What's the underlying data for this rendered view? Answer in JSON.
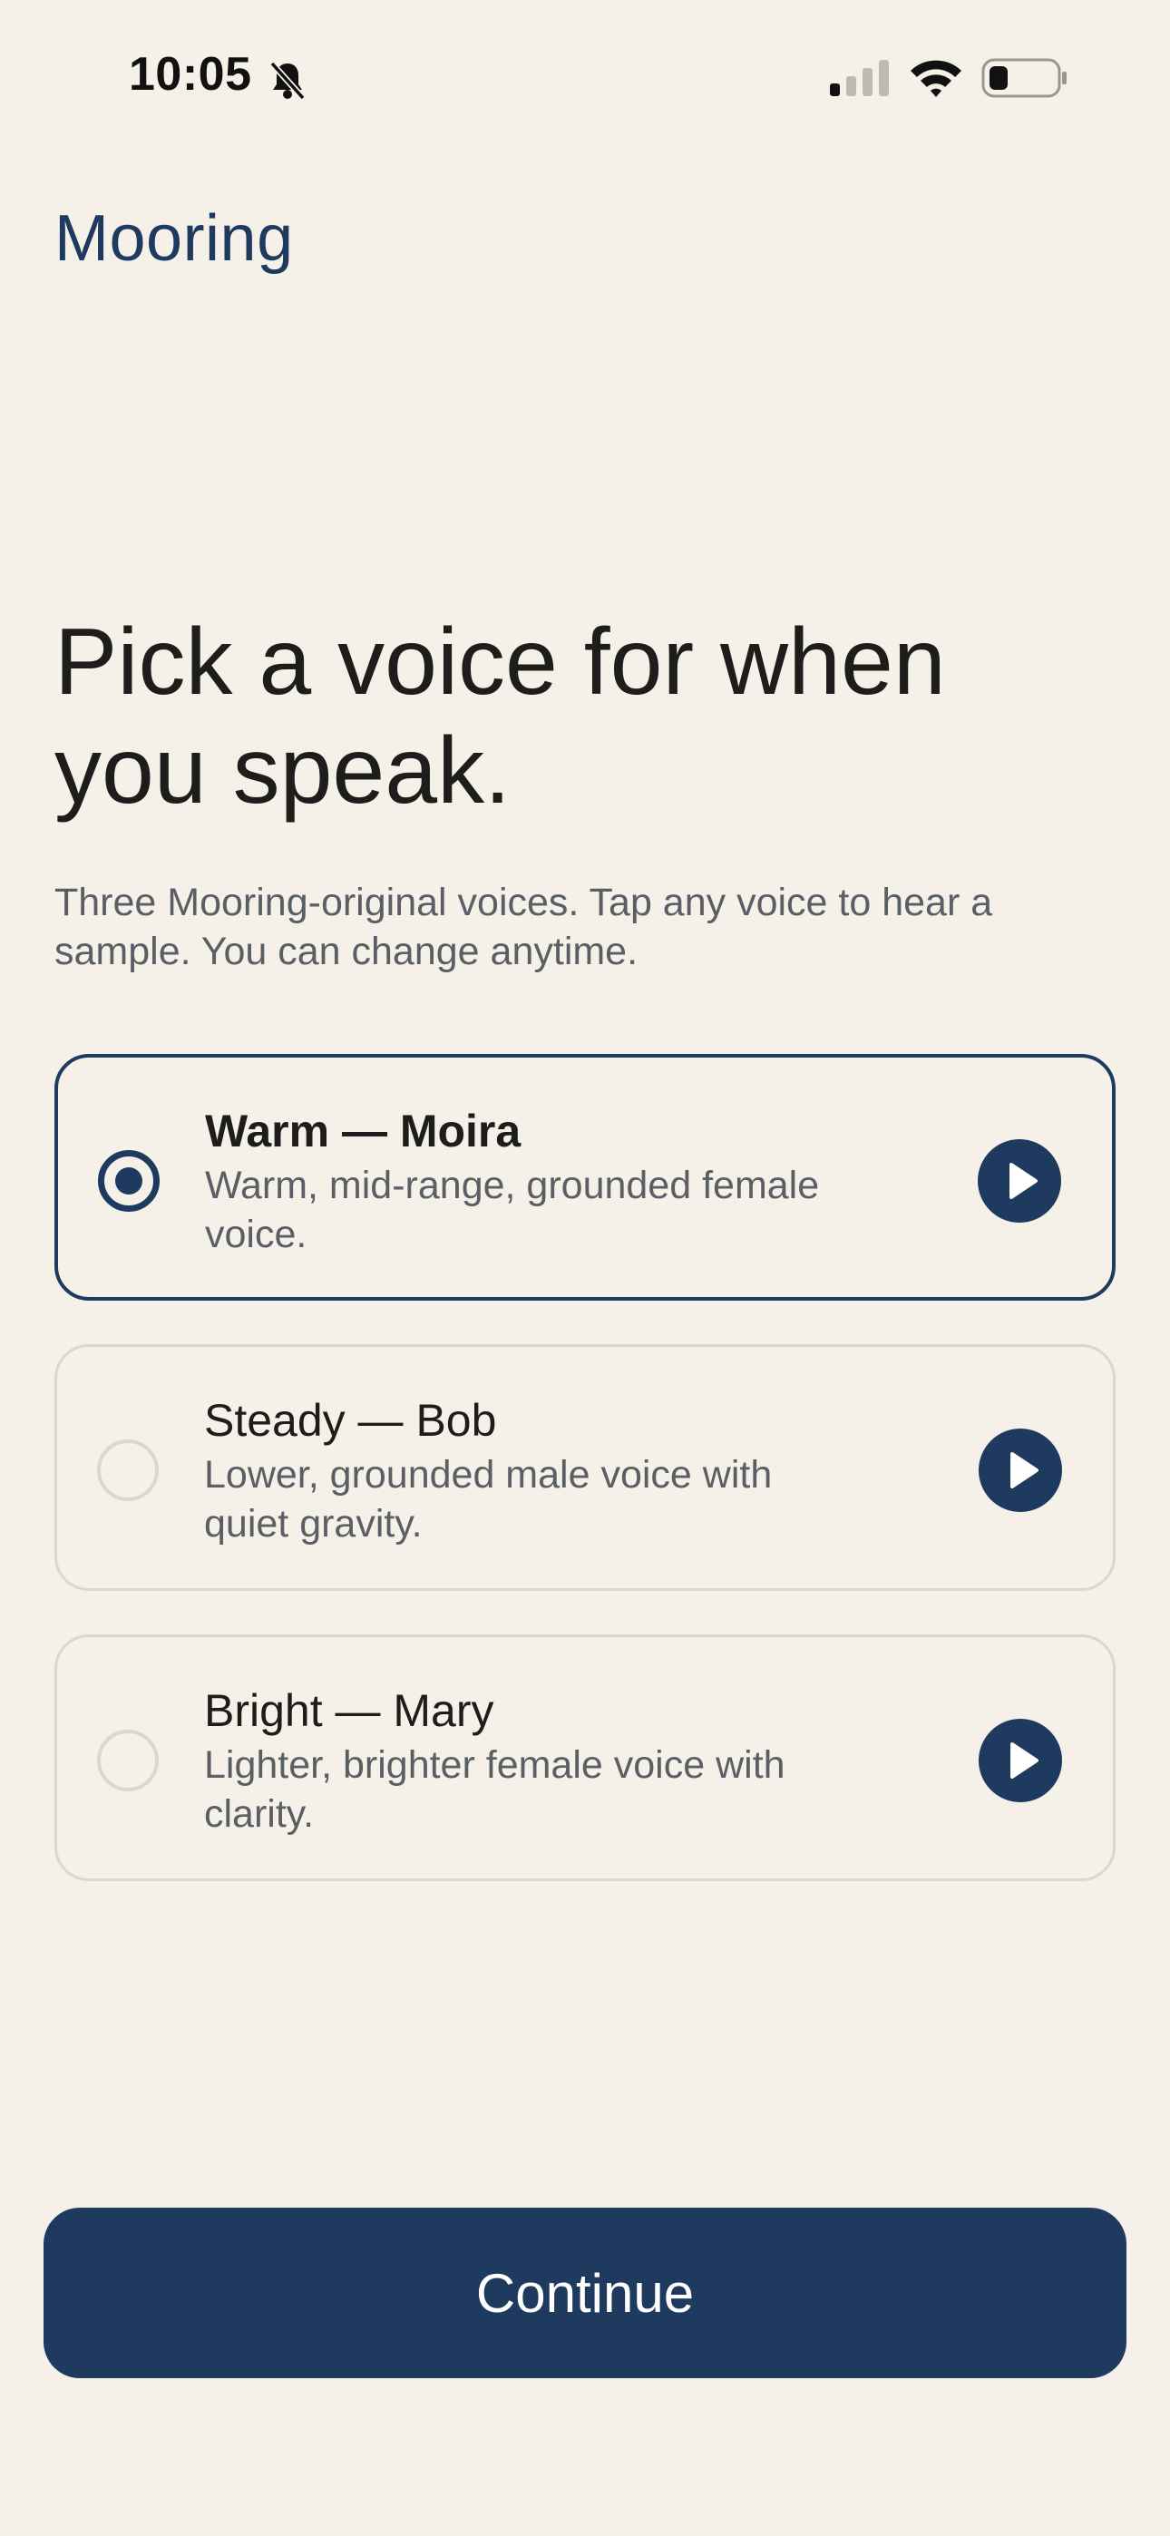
{
  "status_bar": {
    "time": "10:05",
    "icons": [
      "bell-slash-icon",
      "cellular-signal-icon",
      "wifi-icon",
      "battery-icon"
    ]
  },
  "app": {
    "title": "Mooring"
  },
  "main": {
    "heading": "Pick a voice for when you speak.",
    "subtitle": "Three Mooring-original voices. Tap any voice to hear a sample. You can change anytime."
  },
  "voices": [
    {
      "name": "Warm — Moira",
      "description": "Warm, mid-range, grounded female voice.",
      "selected": true,
      "play_icon": "play-icon"
    },
    {
      "name": "Steady — Bob",
      "description": "Lower, grounded male voice with quiet gravity.",
      "selected": false,
      "play_icon": "play-icon"
    },
    {
      "name": "Bright — Mary",
      "description": "Lighter, brighter female voice with clarity.",
      "selected": false,
      "play_icon": "play-icon"
    }
  ],
  "footer": {
    "continue_label": "Continue"
  },
  "colors": {
    "background": "#F5F1E9",
    "accent": "#1F3A5F",
    "text": "#1D1D1B",
    "muted_text": "#5A5F66",
    "card_border": "#DDD7CA"
  }
}
